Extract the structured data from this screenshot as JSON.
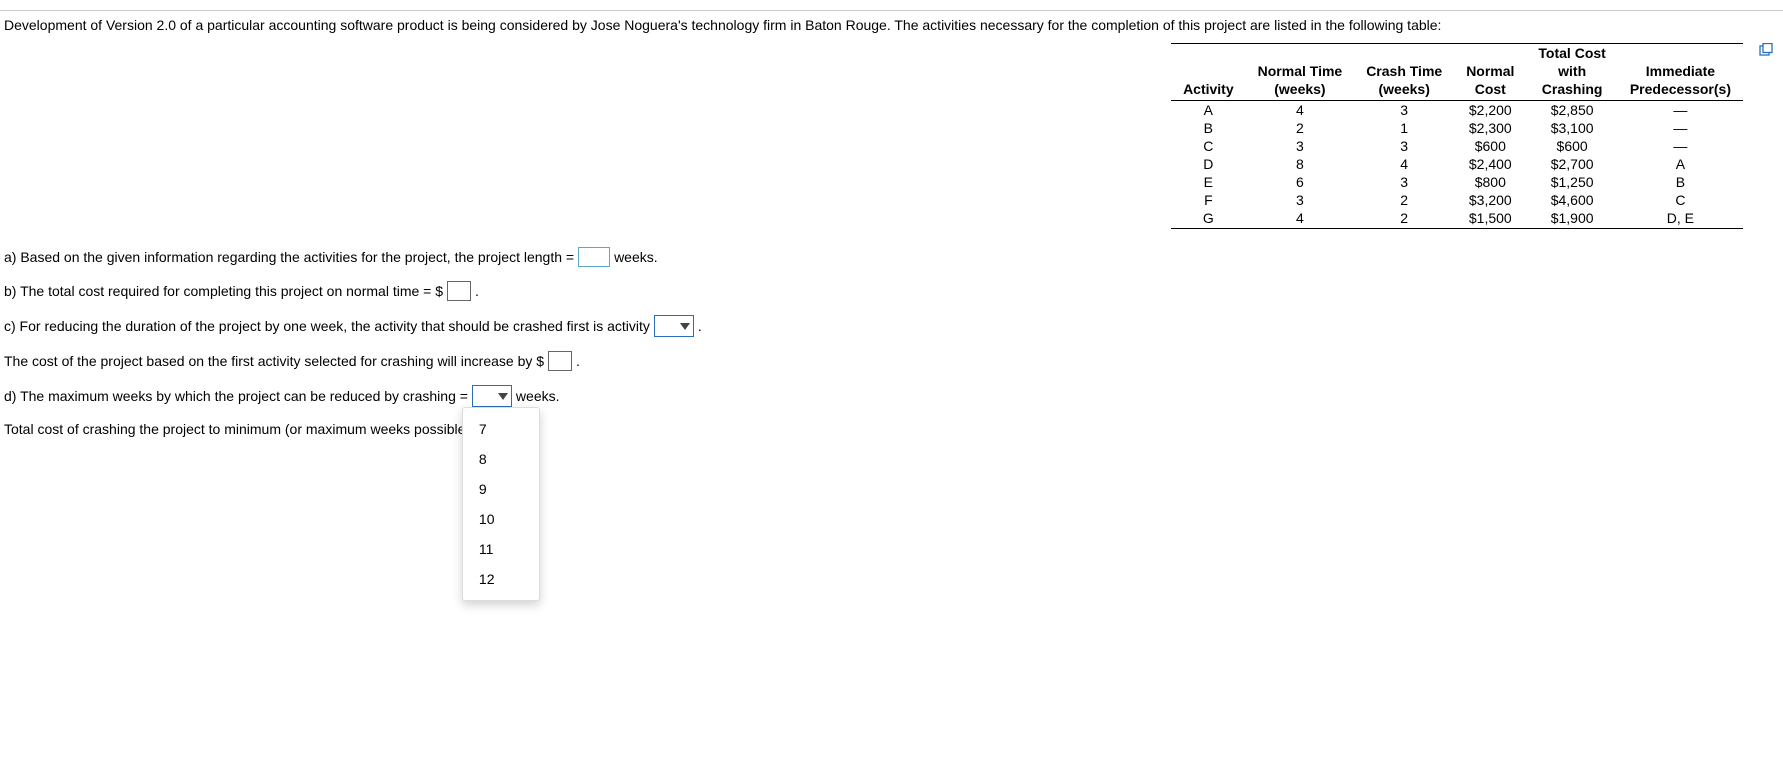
{
  "intro": "Development of Version 2.0 of a particular accounting software product is being considered by Jose Noguera's technology firm in Baton Rouge. The activities necessary for the completion of this project are listed in the following table:",
  "table": {
    "headers": {
      "activity": "Activity",
      "normal_time_l1": "Normal Time",
      "normal_time_l2": "(weeks)",
      "crash_time_l1": "Crash Time",
      "crash_time_l2": "(weeks)",
      "normal_cost_l1": "Normal",
      "normal_cost_l2": "Cost",
      "total_cost_l1": "Total Cost",
      "total_cost_l2": "with",
      "total_cost_l3": "Crashing",
      "pred_l1": "Immediate",
      "pred_l2": "Predecessor(s)"
    },
    "rows": [
      {
        "act": "A",
        "nt": "4",
        "ct": "3",
        "nc": "$2,200",
        "tc": "$2,850",
        "pred": "—"
      },
      {
        "act": "B",
        "nt": "2",
        "ct": "1",
        "nc": "$2,300",
        "tc": "$3,100",
        "pred": "—"
      },
      {
        "act": "C",
        "nt": "3",
        "ct": "3",
        "nc": "$600",
        "tc": "$600",
        "pred": "—"
      },
      {
        "act": "D",
        "nt": "8",
        "ct": "4",
        "nc": "$2,400",
        "tc": "$2,700",
        "pred": "A"
      },
      {
        "act": "E",
        "nt": "6",
        "ct": "3",
        "nc": "$800",
        "tc": "$1,250",
        "pred": "B"
      },
      {
        "act": "F",
        "nt": "3",
        "ct": "2",
        "nc": "$3,200",
        "tc": "$4,600",
        "pred": "C"
      },
      {
        "act": "G",
        "nt": "4",
        "ct": "2",
        "nc": "$1,500",
        "tc": "$1,900",
        "pred": "D, E"
      }
    ]
  },
  "questions": {
    "a_pre": "a) Based on the given information regarding the activities for the project, the project length =",
    "a_post": "weeks.",
    "b_pre": "b) The total cost required for completing this project on normal time = $",
    "b_post": ".",
    "c_pre": "c) For reducing the duration of the project by one week, the activity that should be crashed first is activity",
    "c_post": ".",
    "c2_pre": "The cost of the project based on the first activity selected for crashing will increase by $",
    "c2_post": ".",
    "d_pre": "d) The maximum weeks by which the project can be reduced by crashing =",
    "d_post": "weeks.",
    "e_pre": "Total cost of crashing the project to minimum (or maximum weeks possible)"
  },
  "dropdown_options": [
    "7",
    "8",
    "9",
    "10",
    "11",
    "12"
  ]
}
